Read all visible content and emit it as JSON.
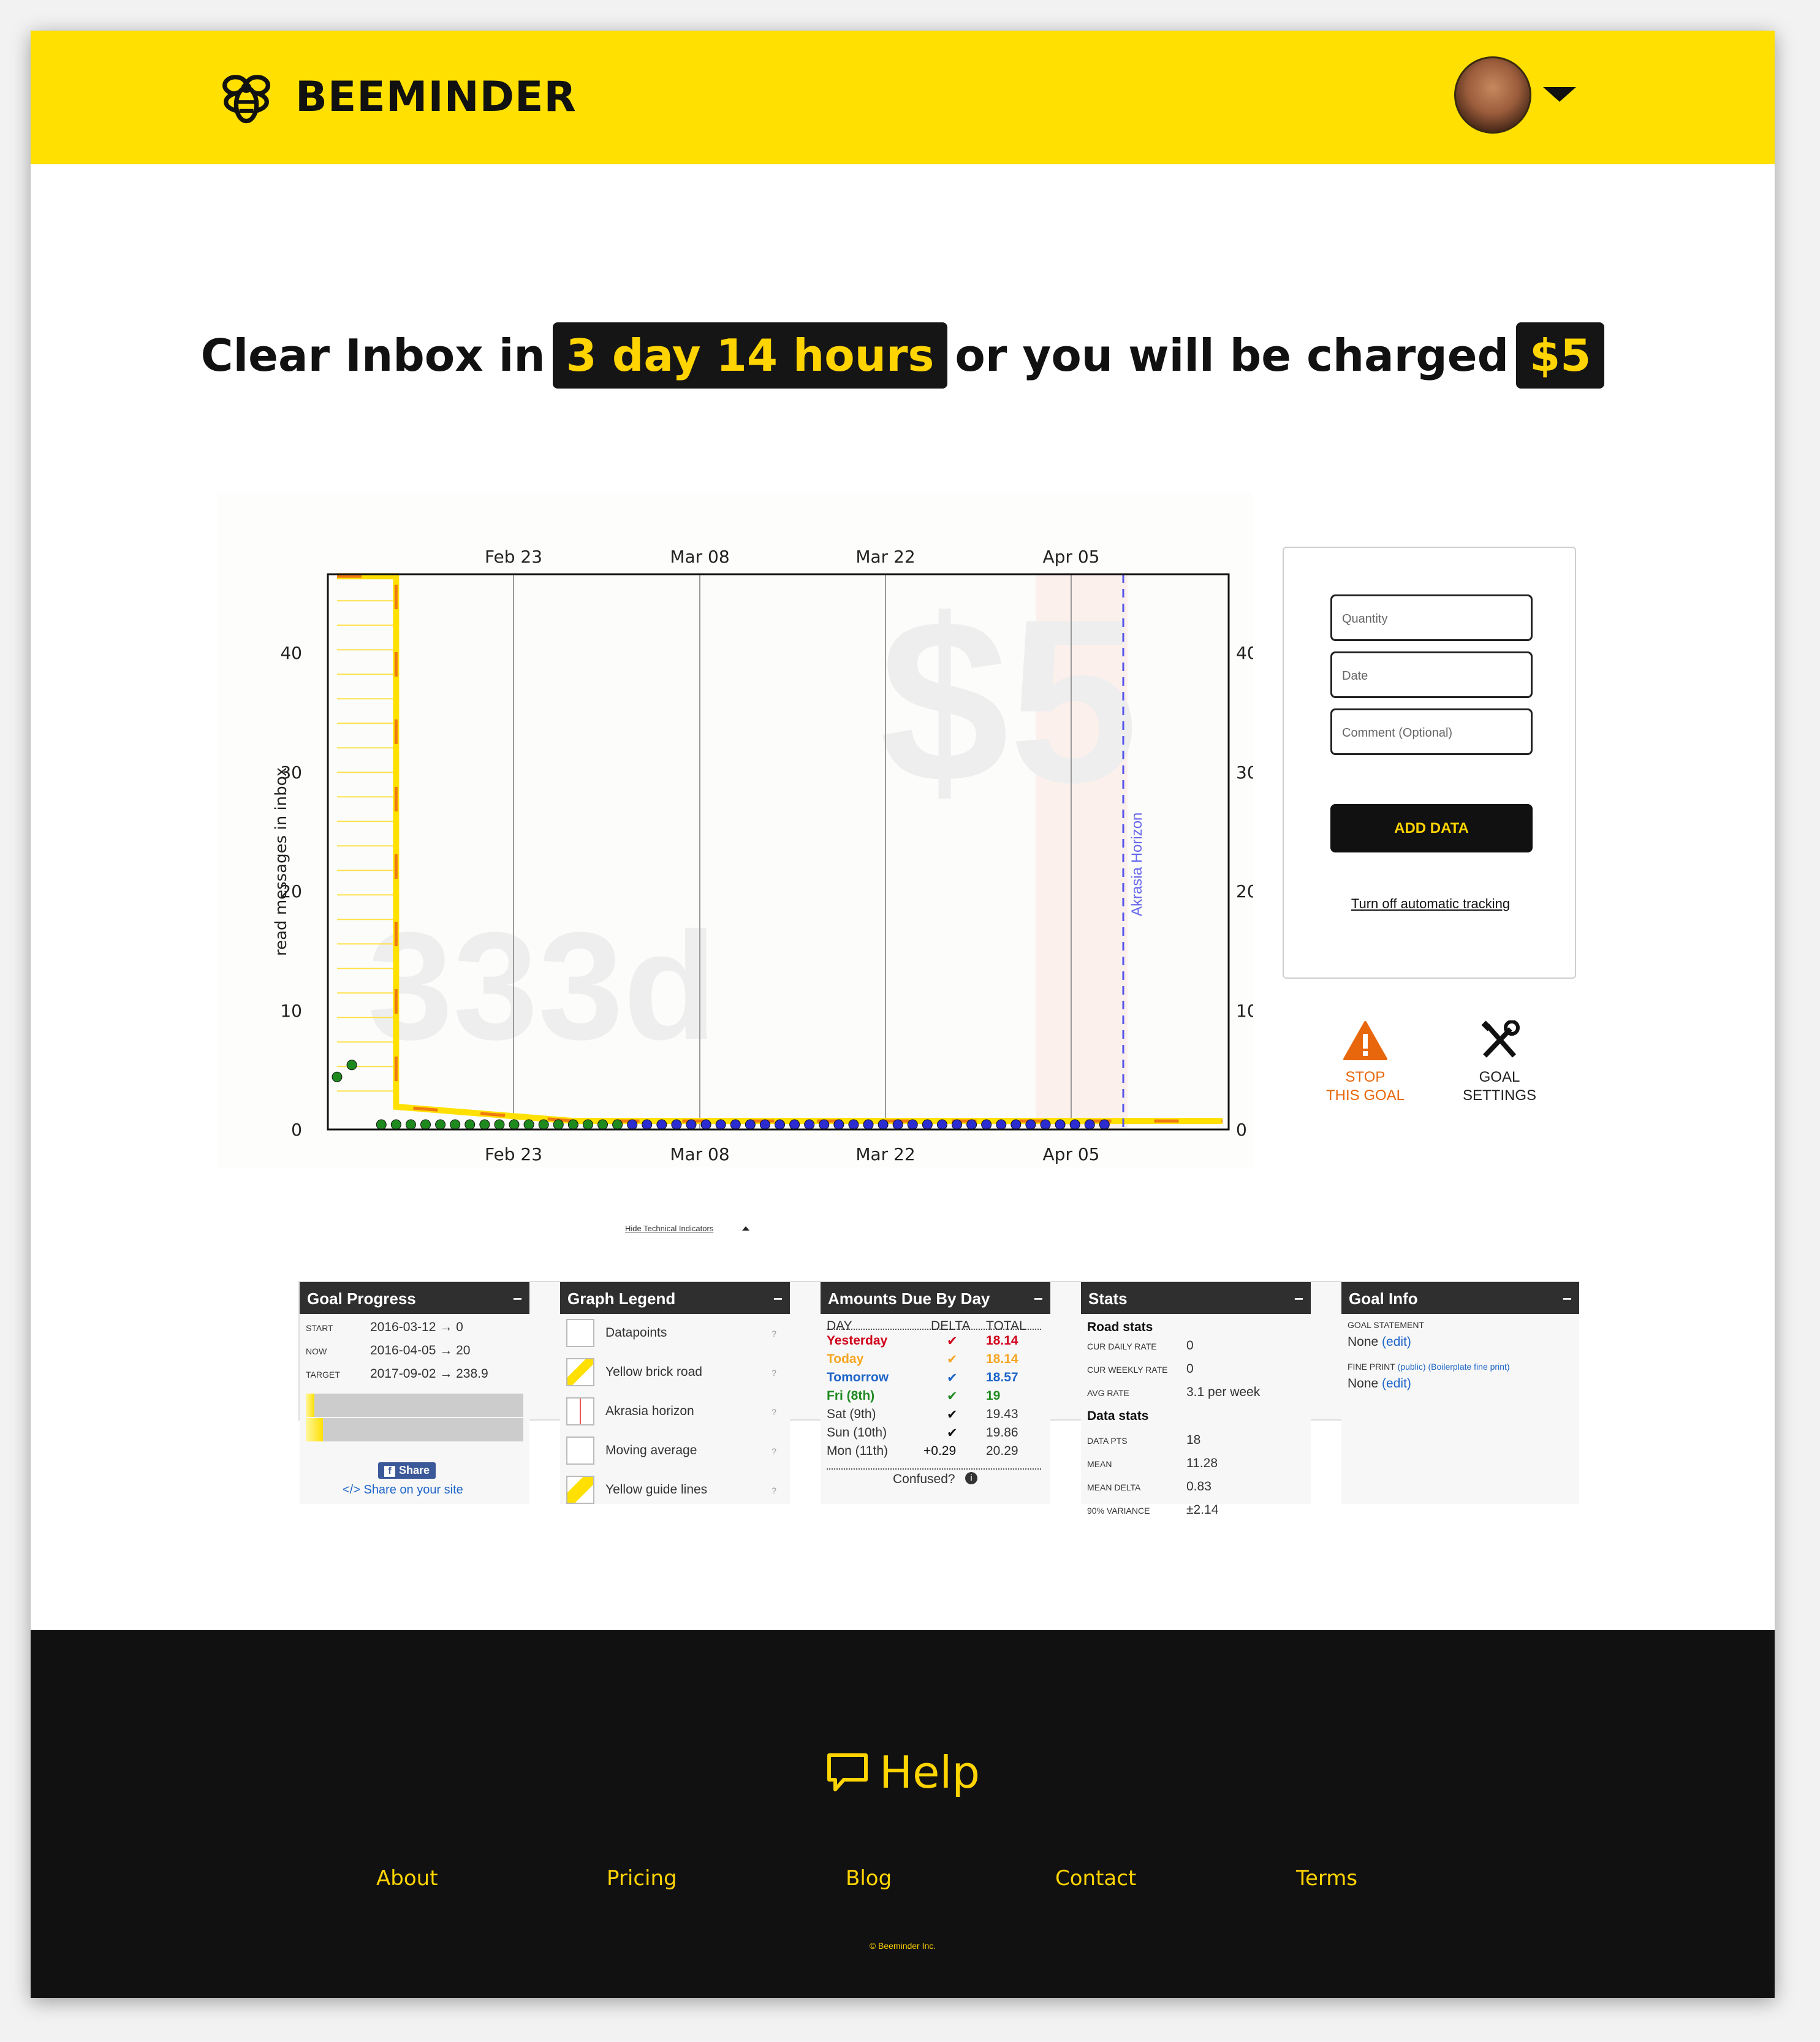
{
  "header": {
    "brand": "BEEMINDER",
    "logo_icon": "bee-logo-icon",
    "avatar": "user-avatar",
    "menu_icon": "caret-down-icon",
    "colors": {
      "yellow": "#ffe000",
      "dark": "#111111"
    }
  },
  "headline": {
    "prefix": "Clear Inbox in",
    "time": "3 day 14 hours",
    "middle": "or you will be charged",
    "amount": "$5"
  },
  "graph": {
    "top_ticks": [
      "Feb 23",
      "Mar 08",
      "Mar 22",
      "Apr 05"
    ],
    "bottom_ticks": [
      "Feb 23",
      "Mar 08",
      "Mar 22",
      "Apr 05"
    ],
    "y_ticks_left": [
      "40",
      "30",
      "20",
      "10",
      "0"
    ],
    "y_ticks_right": [
      "40",
      "30",
      "20",
      "10",
      "0"
    ],
    "ylabel": "read messages in inbox",
    "watermark_pledge": "$5",
    "watermark_days": "333d",
    "akrasia_label": "Akrasia Horizon"
  },
  "chart_data": {
    "type": "scatter",
    "title": "",
    "xlabel": "",
    "ylabel": "read messages in inbox",
    "x_ticks": [
      "Feb 23",
      "Mar 08",
      "Mar 22",
      "Apr 05"
    ],
    "ylim": [
      0,
      46
    ],
    "series": [
      {
        "color": "#1e8a1e",
        "points": [
          [
            0,
            4
          ],
          [
            1,
            5
          ],
          [
            3,
            0
          ],
          [
            4,
            0
          ],
          [
            5,
            0
          ],
          [
            6,
            0
          ],
          [
            7,
            0
          ],
          [
            8,
            0
          ],
          [
            9,
            0
          ],
          [
            10,
            0
          ],
          [
            11,
            0
          ],
          [
            12,
            0
          ],
          [
            13,
            0
          ],
          [
            14,
            0
          ],
          [
            15,
            0
          ],
          [
            16,
            0
          ],
          [
            17,
            0
          ],
          [
            18,
            0
          ],
          [
            19,
            0
          ]
        ]
      },
      {
        "color": "#2c2cd0",
        "points": [
          [
            20,
            0
          ],
          [
            21,
            0
          ],
          [
            22,
            0
          ],
          [
            23,
            0
          ],
          [
            24,
            0
          ],
          [
            25,
            0
          ],
          [
            26,
            0
          ],
          [
            27,
            0
          ],
          [
            28,
            0
          ],
          [
            29,
            0
          ],
          [
            30,
            0
          ],
          [
            31,
            0
          ],
          [
            32,
            0
          ],
          [
            33,
            0
          ],
          [
            34,
            0
          ],
          [
            35,
            0
          ],
          [
            36,
            0
          ],
          [
            37,
            0
          ],
          [
            38,
            0
          ],
          [
            39,
            0
          ],
          [
            40,
            0
          ],
          [
            41,
            0
          ],
          [
            42,
            0
          ],
          [
            43,
            0
          ],
          [
            44,
            0
          ],
          [
            45,
            0
          ],
          [
            46,
            0
          ],
          [
            47,
            0
          ],
          [
            48,
            0
          ],
          [
            49,
            0
          ],
          [
            50,
            0
          ],
          [
            51,
            0
          ],
          [
            52,
            0
          ]
        ]
      }
    ],
    "road": {
      "color": "#ffe000",
      "points": [
        [
          0,
          46
        ],
        [
          4,
          46
        ],
        [
          4,
          1.5
        ],
        [
          16,
          0.3
        ],
        [
          60,
          0.3
        ]
      ]
    },
    "grid": true
  },
  "entry": {
    "quantity_placeholder": "Quantity",
    "date_placeholder": "Date",
    "comment_placeholder": "Comment (Optional)",
    "add_label": "ADD DATA",
    "turnoff": "Turn off automatic tracking"
  },
  "actions": {
    "stop_line1": "STOP",
    "stop_line2": "THIS GOAL",
    "stop_icon": "warning-icon",
    "settings_line1": "GOAL",
    "settings_line2": "SETTINGS",
    "settings_icon": "tools-icon"
  },
  "hide_indicators": "Hide Technical Indicators",
  "panels": {
    "goal_progress": {
      "title": "Goal Progress",
      "rows": [
        {
          "label": "START",
          "value": "2016-03-12 → 0"
        },
        {
          "label": "NOW",
          "value": "2016-04-05 → 20"
        },
        {
          "label": "TARGET",
          "value": "2017-09-02 → 238.9"
        }
      ],
      "progress": [
        0.04,
        0.08
      ],
      "share_label": "Share",
      "share_site": "</> Share on your site"
    },
    "legend": {
      "title": "Graph Legend",
      "items": [
        "Datapoints",
        "Yellow brick road",
        "Akrasia horizon",
        "Moving average",
        "Yellow guide lines"
      ],
      "help_mark": "?"
    },
    "amounts": {
      "title": "Amounts Due By Day",
      "cols": [
        "DAY",
        "DELTA",
        "TOTAL"
      ],
      "rows": [
        {
          "day": "Yesterday",
          "delta": "✔",
          "total": "18.14",
          "color": "#d0021b"
        },
        {
          "day": "Today",
          "delta": "✔",
          "total": "18.14",
          "color": "#f5a623"
        },
        {
          "day": "Tomorrow",
          "delta": "✔",
          "total": "18.57",
          "color": "#1c64c9"
        },
        {
          "day": "Fri (8th)",
          "delta": "✔",
          "total": "19",
          "color": "#1e8a1e"
        },
        {
          "day": "Sat (9th)",
          "delta": "✔",
          "total": "19.43",
          "color": "#333333"
        },
        {
          "day": "Sun (10th)",
          "delta": "✔",
          "total": "19.86",
          "color": "#333333"
        },
        {
          "day": "Mon (11th)",
          "delta": "+0.29",
          "total": "20.29",
          "color": "#333333"
        }
      ],
      "confused": "Confused?"
    },
    "stats": {
      "title": "Stats",
      "road_title": "Road stats",
      "road": [
        {
          "label": "CUR DAILY RATE",
          "value": "0"
        },
        {
          "label": "CUR WEEKLY RATE",
          "value": "0"
        },
        {
          "label": "AVG RATE",
          "value": "3.1 per week"
        }
      ],
      "data_title": "Data stats",
      "data": [
        {
          "label": "DATA PTS",
          "value": "18"
        },
        {
          "label": "MEAN",
          "value": "11.28"
        },
        {
          "label": "MEAN DELTA",
          "value": "0.83"
        },
        {
          "label": "90% VARIANCE",
          "value": "±2.14"
        }
      ]
    },
    "goal_info": {
      "title": "Goal Info",
      "statement_label": "GOAL STATEMENT",
      "statement_value": "None",
      "fine_label": "FINE PRINT",
      "fine_public": "(public)",
      "fine_boiler": "(Boilerplate fine print)",
      "fine_value": "None",
      "edit": "(edit)"
    },
    "collapse": "−"
  },
  "footer": {
    "help": "Help",
    "help_icon": "speech-bubble-icon",
    "links": [
      "About",
      "Pricing",
      "Blog",
      "Contact",
      "Terms"
    ],
    "copyright": "© Beeminder Inc."
  }
}
